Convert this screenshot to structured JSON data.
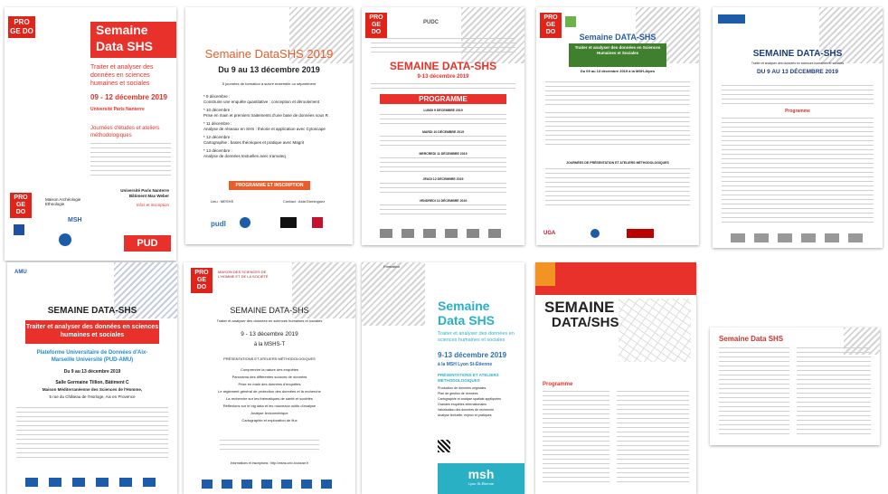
{
  "p1": {
    "logo": "PRO GE DO",
    "title1": "Semaine",
    "title2": "Data SHS",
    "subtitle": "Traiter et analyser des données en sciences humaines et sociales",
    "dates": "09 - 12 décembre 2019",
    "univ": "Université Paris Nanterre",
    "journees": "Journées d'études et ateliers méthodologiques",
    "site1": "Université Paris Nanterre",
    "site2": "Bâtiment Max Weber",
    "infos": "Infos et inscription",
    "maison": "Maison Archéologie Ethnologie",
    "msh": "MSH",
    "pud": "PUD"
  },
  "p2": {
    "title": "Semaine DataSHS 2019",
    "dates": "Du 9 au 13 décembre 2019",
    "intro": "5 journées de formation à suivre ensemble ou séparément",
    "d9": "* 9 décembre :",
    "d9t": "Construire une enquête quantitative : conception et déroulement",
    "d10": "* 10 décembre :",
    "d10t": "Prise en main et premiers traitements d'une base de données sous R",
    "d11": "* 11 décembre :",
    "d11t": "Analyse de réseaux en SHS : théorie et application avec Cytoscape",
    "d12": "* 12 décembre :",
    "d12t": "Cartographie : bases théoriques et pratique avec Magrit",
    "d13": "* 13 décembre :",
    "d13t": "Analyse de données textuelles avec Iramuteq",
    "btn": "PROGRAMME ET INSCRIPTION",
    "lieu": "Lieu : MESHS",
    "contact": "Contact : Asta Dominguez",
    "pudl": "pudl"
  },
  "p3": {
    "logo": "PRO GE DO",
    "pudc": "PUDC",
    "title": "SEMAINE DATA-SHS",
    "dates": "9-13 décembre 2019",
    "prog": "PROGRAMME",
    "s1": "LUNDI 9 DÉCEMBRE 2019",
    "s2": "MARDI 10 DÉCEMBRE 2019",
    "s3": "MERCREDI 11 DÉCEMBRE 2019",
    "s4": "JEUDI 12 DÉCEMBRE 2019",
    "s5": "VENDREDI 13 DÉCEMBRE 2019"
  },
  "p4": {
    "title": "Semaine DATA-SHS",
    "subtitle": "Traiter et analyser des données en Sciences Humaines et Sociales",
    "dates": "Du 09 au 13 décembre 2019 à la MSH-Alpes",
    "sec": "JOURNÉES DE PRÉSENTATION ET ATELIERS MÉTHODOLOGIQUES",
    "uga": "UGA"
  },
  "p5": {
    "title": "SEMAINE DATA-SHS",
    "subtitle": "Traiter et analyser des données en sciences humaines et sociales",
    "dates": "DU 9 AU 13 DÉCEMBRE 2019",
    "prog": "Programme"
  },
  "p6": {
    "logo": "AMU",
    "title": "SEMAINE DATA-SHS",
    "red": "Traiter et analyser des données en sciences humaines et sociales",
    "plat": "Plateforme Universitaire de Données d'Aix-Marseille Université (PUD-AMU)",
    "dates": "Du 9 au 13 décembre 2019",
    "salle": "Salle Germaine Tillion, Bâtiment C",
    "maison": "Maison Méditerranéenne des Sciences de l'Homme,",
    "adresse": "5 rue du Château de l'Horloge, Aix en Provence"
  },
  "p7": {
    "logo": "PRO GE DO",
    "maison": "MAISON DES SCIENCES DE L'HOMME ET DE LA SOCIÉTÉ",
    "title": "SEMAINE DATA-SHS",
    "subtitle": "Traiter et analyser des données en sciences humaines et sociales",
    "dates": "9 - 13 décembre 2019",
    "lieu": "à la MSHS-T",
    "pres": "PRÉSENTATIONS ET ATELIERS MÉTHODOLOGIQUES",
    "items": [
      "Comprendre la nature des enquêtes",
      "Panorama des différentes sources de données",
      "Prise en main des données d'enquêtes",
      "Le règlement général de protection des données et la recherche",
      "La recherche sur les thématiques de santé et sociétés",
      "Réflexions sur le big data et les nouveaux outils d'analyse",
      "Analyse lexicométrique",
      "Cartographie et exploration de flux"
    ],
    "infos": "Informations et inscriptions : http://mshs.univ-toulouse.fr"
  },
  "p8": {
    "formation": "Formation",
    "title1": "Semaine",
    "title2": "Data SHS",
    "subtitle": "Traiter et analyser des données en sciences humaines et sociales",
    "dates": "9-13 décembre 2019",
    "lieu": "à la MSH Lyon St-Étienne",
    "pres": "PRÉSENTATIONS ET ATELIERS MÉTHODOLOGIQUES",
    "items": [
      "Production de données originales",
      "Plan de gestion de données",
      "Cartographie et analyse spatiale appliquées",
      "Grandes enquêtes internationales",
      "Valorisation des données de recherche",
      "Analyse textuelle, enjeux et pratiques"
    ],
    "msh": "msh",
    "msh_sub": "Lyon St-Étienne"
  },
  "p9": {
    "title1": "SEMAINE",
    "title2": "DATA/SHS",
    "prog": "Programme"
  },
  "p10": {
    "title": "Semaine Data SHS"
  }
}
